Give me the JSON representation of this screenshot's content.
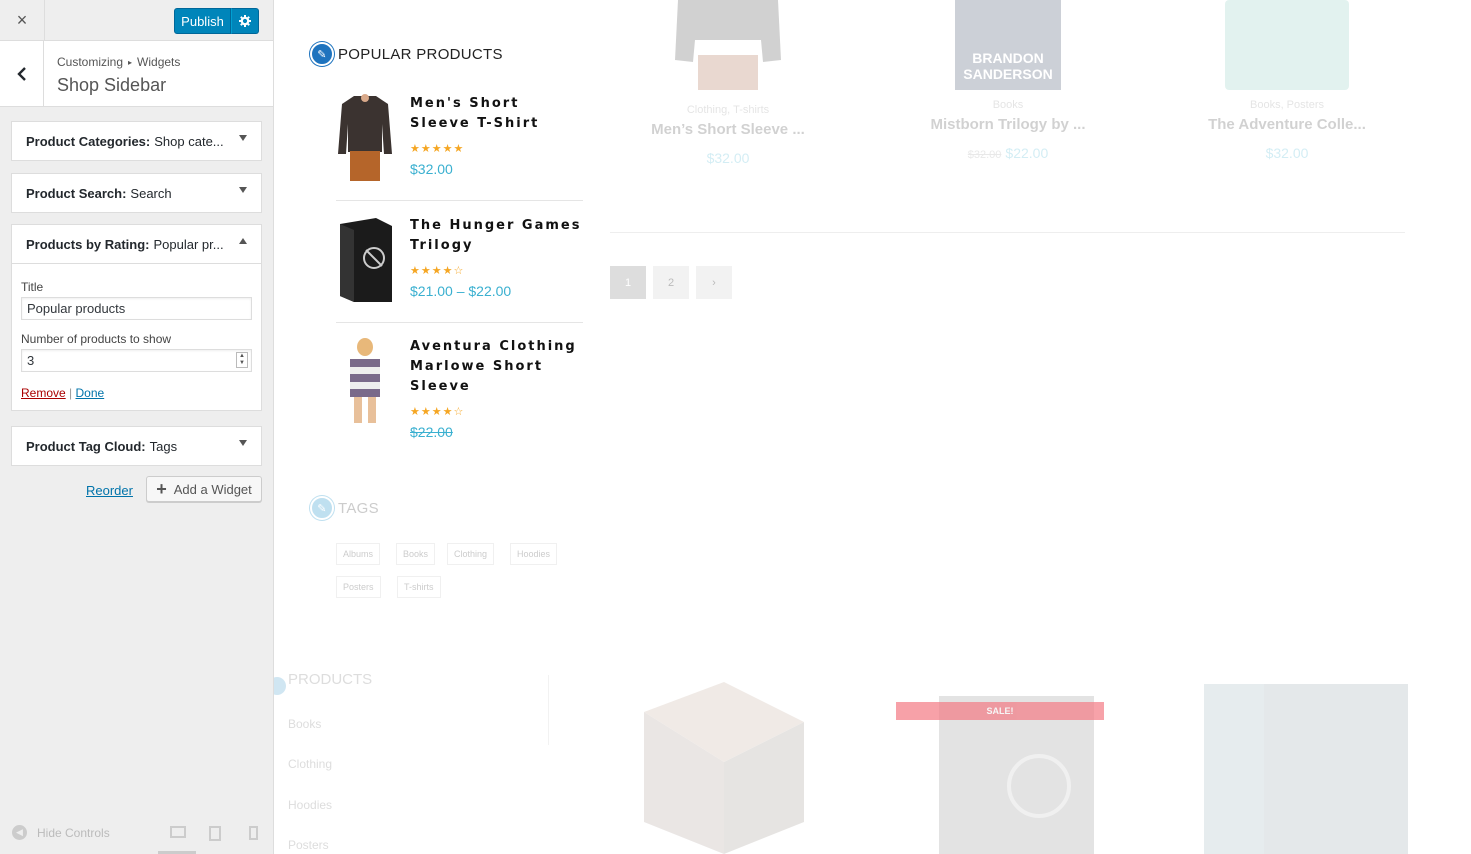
{
  "customizer": {
    "close_label": "×",
    "publish_label": "Publish",
    "breadcrumb": {
      "part1": "Customizing",
      "sep": "▸",
      "part2": "Widgets"
    },
    "section_title": "Shop Sidebar",
    "widgets": [
      {
        "type": "Product Categories:",
        "name": "Shop cate..."
      },
      {
        "type": "Product Search:",
        "name": "Search"
      },
      {
        "type": "Products by Rating:",
        "name": "Popular pr..."
      },
      {
        "type": "Product Tag Cloud:",
        "name": "Tags"
      }
    ],
    "rating_form": {
      "title_label": "Title",
      "title_value": "Popular products",
      "count_label": "Number of products to show",
      "count_value": "3",
      "remove_label": "Remove",
      "separator": "|",
      "done_label": "Done"
    },
    "reorder_label": "Reorder",
    "add_widget_label": "Add a Widget",
    "hide_controls_label": "Hide Controls"
  },
  "preview": {
    "popular": {
      "title": "POPULAR PRODUCTS",
      "items": [
        {
          "name": "Men's Short Sleeve T-Shirt",
          "stars": "★★★★★",
          "price": "$32.00"
        },
        {
          "name": "The Hunger Games Trilogy",
          "stars": "★★★★☆",
          "price": "$21.00 – $22.00"
        },
        {
          "name": "Aventura Clothing Marlowe Short Sleeve",
          "stars": "★★★★☆",
          "price": "$22.00"
        }
      ]
    },
    "grid": [
      {
        "cat": "Clothing, T-shirts",
        "name": "Men’s Short Sleeve ...",
        "old_price": "",
        "price": "$32.00"
      },
      {
        "cat": "Books",
        "name": "Mistborn Trilogy by ...",
        "old_price": "$32.00",
        "price": "$22.00",
        "cover_line1": "BRANDON",
        "cover_line2": "SANDERSON"
      },
      {
        "cat": "Books, Posters",
        "name": "The Adventure Colle...",
        "old_price": "",
        "price": "$32.00"
      }
    ],
    "pagination": [
      "1",
      "2",
      "›"
    ],
    "tags": {
      "title": "TAGS",
      "items": [
        "Albums",
        "Books",
        "Clothing",
        "Hoodies",
        "Posters",
        "T-shirts"
      ]
    },
    "products": {
      "title": "PRODUCTS",
      "links": [
        "Books",
        "Clothing",
        "Hoodies",
        "Posters"
      ]
    },
    "sale_badge": "SALE!",
    "accent_color": "#1e73be",
    "price_color": "#3ab0d0",
    "star_color": "#f5a623"
  }
}
